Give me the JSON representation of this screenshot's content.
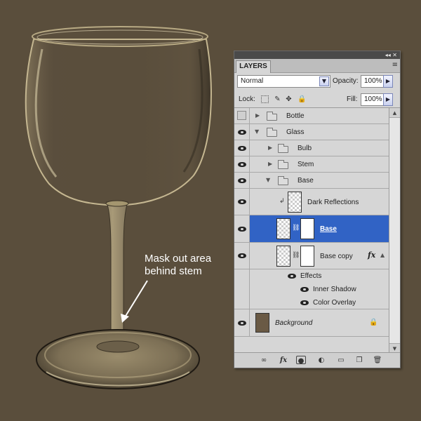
{
  "annotation": {
    "line1": "Mask out area",
    "line2": "behind stem"
  },
  "panel": {
    "tab_label": "LAYERS",
    "window_controls": "◂◂ ✕",
    "menu_icon": "≡",
    "blend_mode": "Normal",
    "opacity_label": "Opacity:",
    "opacity_value": "100%",
    "lock_label": "Lock:",
    "fill_label": "Fill:",
    "fill_value": "100%"
  },
  "layers": {
    "bottle": "Bottle",
    "glass": "Glass",
    "bulb": "Bulb",
    "stem": "Stem",
    "base_group": "Base",
    "dark_reflections": "Dark Reflections",
    "base": "Base",
    "base_copy": "Base copy",
    "effects": "Effects",
    "inner_shadow": "Inner Shadow",
    "color_overlay": "Color Overlay",
    "background": "Background"
  },
  "colors": {
    "canvas_bg": "#5a4e3c",
    "selection": "#3163c5",
    "glass_tint": "#b8a880"
  }
}
